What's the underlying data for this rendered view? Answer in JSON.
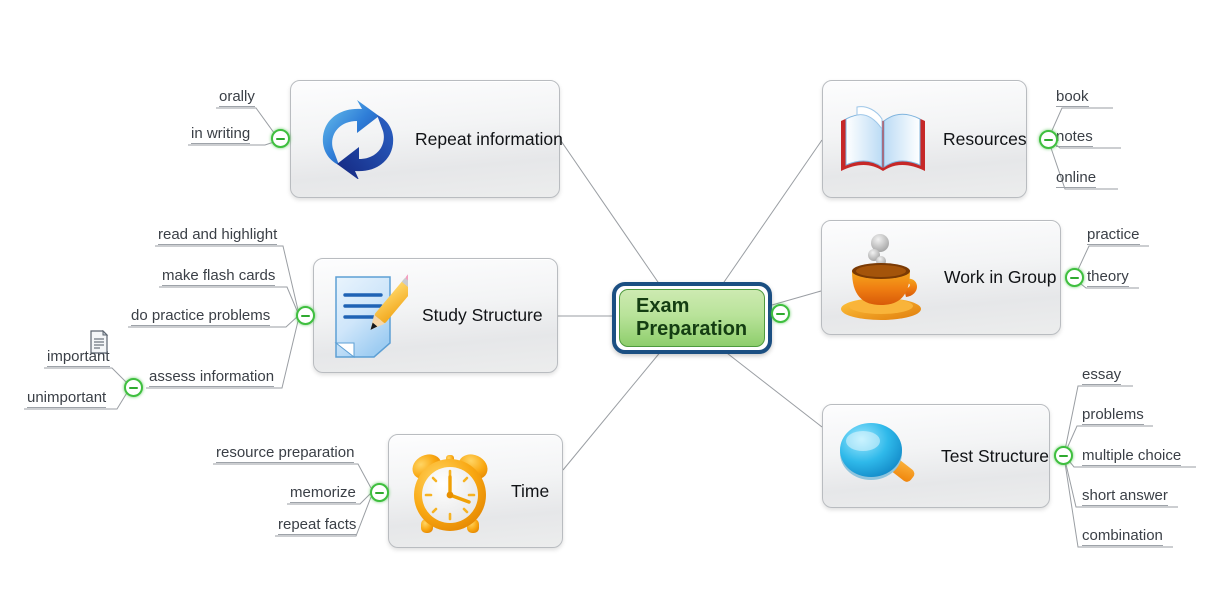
{
  "diagram": {
    "type": "mind-map",
    "central_topic": {
      "text": "Exam\nPreparation",
      "border_color": "#1b4f82",
      "fill_color": "#aadd88"
    },
    "branches": [
      {
        "id": "repeat-information",
        "label": "Repeat information",
        "icon": "refresh-arrows-icon",
        "side": "left",
        "children": [
          "orally",
          "in writing"
        ]
      },
      {
        "id": "study-structure",
        "label": "Study Structure",
        "icon": "document-pencil-icon",
        "side": "left",
        "children": [
          "read and highlight",
          "make flash cards",
          "do practice  problems",
          "assess information"
        ],
        "subchildren": {
          "parent": "assess information",
          "items": [
            "important",
            "unimportant"
          ],
          "note_icon": "note-document-icon"
        }
      },
      {
        "id": "time",
        "label": "Time",
        "icon": "alarm-clock-icon",
        "side": "left",
        "children": [
          "resource preparation",
          "memorize",
          "repeat facts"
        ]
      },
      {
        "id": "resources",
        "label": "Resources",
        "icon": "open-book-icon",
        "side": "right",
        "children": [
          "book",
          "notes",
          "online"
        ]
      },
      {
        "id": "work-in-group",
        "label": "Work in Group",
        "icon": "coffee-cup-icon",
        "side": "right",
        "children": [
          "practice",
          "theory"
        ]
      },
      {
        "id": "test-structure",
        "label": "Test Structure",
        "icon": "magnifying-glass-icon",
        "side": "right",
        "children": [
          "essay",
          "problems",
          "multiple choice",
          "short answer",
          "combination"
        ]
      }
    ],
    "collapse_button": {
      "glyph": "minus",
      "color": "#3fbf3f"
    }
  }
}
